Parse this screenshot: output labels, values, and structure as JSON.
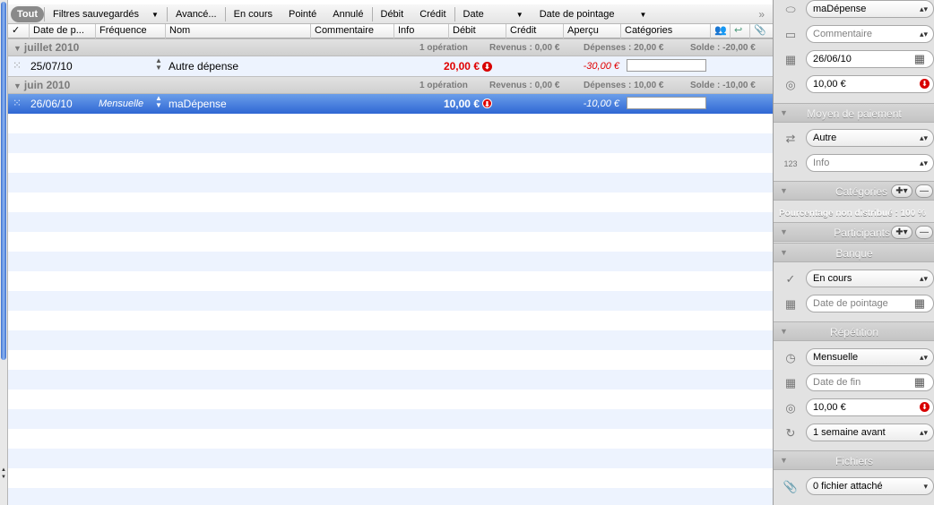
{
  "toolbar": {
    "all": "Tout",
    "saved_filters": "Filtres sauvegardés",
    "advanced": "Avancé...",
    "in_progress": "En cours",
    "checked": "Pointé",
    "cancelled": "Annulé",
    "debit": "Débit",
    "credit": "Crédit",
    "date": "Date",
    "checking_date": "Date de pointage",
    "more": "»"
  },
  "columns": {
    "check": "✓",
    "date": "Date de p...",
    "frequency": "Fréquence",
    "name": "Nom",
    "comment": "Commentaire",
    "info": "Info",
    "debit": "Débit",
    "credit": "Crédit",
    "preview": "Aperçu",
    "categories": "Catégories"
  },
  "groups": [
    {
      "title": "juillet 2010",
      "count": "1 opération",
      "income": "Revenus : 0,00 €",
      "expenses": "Dépenses : 20,00 €",
      "balance": "Solde : -20,00 €",
      "row": {
        "date": "25/07/10",
        "frequency": "",
        "name": "Autre dépense",
        "debit": "20,00 €",
        "preview": "-30,00 €"
      }
    },
    {
      "title": "juin 2010",
      "count": "1 opération",
      "income": "Revenus : 0,00 €",
      "expenses": "Dépenses : 10,00 €",
      "balance": "Solde : -10,00 €",
      "row": {
        "date": "26/06/10",
        "frequency": "Mensuelle",
        "name": "maDépense",
        "debit": "10,00 €",
        "preview": "-10,00 €"
      }
    }
  ],
  "inspector": {
    "name": "maDépense",
    "comment_placeholder": "Commentaire",
    "date": "26/06/10",
    "amount": "10,00 €",
    "payment_section": "Moyen de paiement",
    "payment_mode": "Autre",
    "info_placeholder": "Info",
    "categories_section": "Catégories",
    "unallocated": "Pourcentage non distribué : 100 %",
    "participants_section": "Participants",
    "bank_section": "Banque",
    "status": "En cours",
    "checking_date_placeholder": "Date de pointage",
    "repeat_section": "Répétition",
    "repeat": "Mensuelle",
    "end_date_placeholder": "Date de fin",
    "repeat_amount": "10,00 €",
    "reminder": "1 semaine avant",
    "files_section": "Fichiers",
    "files": "0 fichier attaché"
  },
  "colors": {
    "selection": "#3a72d9",
    "expense": "#e00000",
    "stripe": "#edf3fe"
  }
}
